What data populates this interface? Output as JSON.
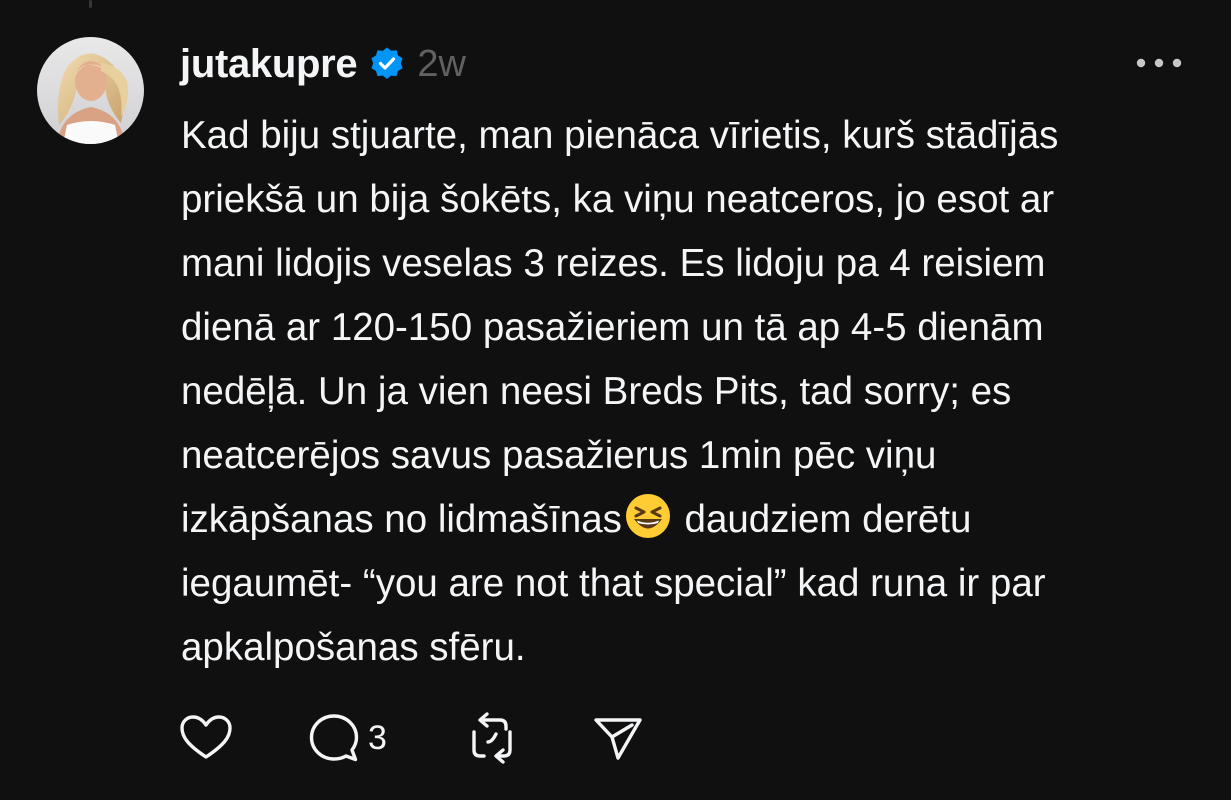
{
  "post": {
    "author": {
      "username": "jutakupre",
      "verified": true,
      "avatar": "user-avatar"
    },
    "timestamp": "2w",
    "text_lines": [
      "Kad biju stjuarte, man pienāca vīrietis, kurš stādījās",
      "priekšā un bija šokēts, ka viņu neatceros, jo esot ar",
      "mani lidojis veselas 3 reizes. Es lidoju pa 4 reisiem",
      "dienā ar 120-150 pasažieriem un tā ap 4-5 dienām",
      "nedēļā. Un ja vien neesi Breds Pits, tad sorry; es",
      "neatcerējos savus pasažierus 1min pēc viņu",
      {
        "before": "izkāpšanas no lidmašīnas",
        "emoji": "grinning-squinting-face",
        "after": " daudziem derētu"
      },
      "iegaumēt- “you are not that special” kad runa ir par",
      "apkalpošanas sfēru."
    ],
    "actions": {
      "like": {
        "icon": "heart-icon"
      },
      "reply": {
        "icon": "comment-icon",
        "count": "3"
      },
      "repost": {
        "icon": "repost-icon"
      },
      "share": {
        "icon": "send-icon"
      }
    },
    "menu_icon": "more-icon"
  },
  "colors": {
    "background": "#101010",
    "text": "#f3f5f7",
    "secondary": "#616161",
    "verified": "#0095f6"
  }
}
